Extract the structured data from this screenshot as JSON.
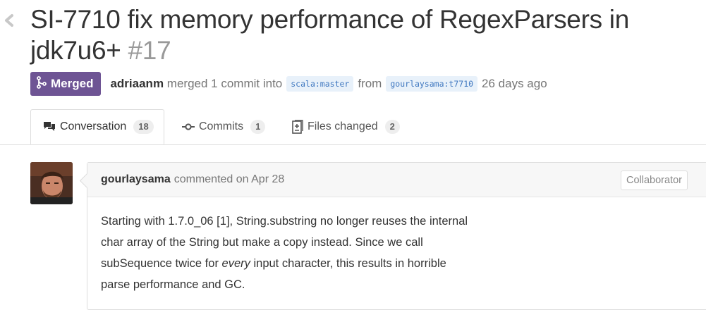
{
  "header": {
    "title": "SI-7710 fix memory performance of RegexParsers in jdk7u6+",
    "number": "#17",
    "back_icon": "chevron-left-icon"
  },
  "meta": {
    "state": "Merged",
    "state_color": "#6e5494",
    "author": "adriaanm",
    "merged_text": "merged 1 commit into",
    "base_ref": "scala:master",
    "from_text": "from",
    "head_ref": "gourlaysama:t7710",
    "time": "26 days ago"
  },
  "tabs": [
    {
      "label": "Conversation",
      "count": "18",
      "icon": "comment-discussion-icon",
      "selected": true
    },
    {
      "label": "Commits",
      "count": "1",
      "icon": "git-commit-icon",
      "selected": false
    },
    {
      "label": "Files changed",
      "count": "2",
      "icon": "diff-icon",
      "selected": false
    }
  ],
  "comment": {
    "author": "gourlaysama",
    "action": "commented on Apr 28",
    "role": "Collaborator",
    "lines": [
      "Starting with 1.7.0_06 [1], String.substring no longer reuses the internal",
      "char array of the String but make a copy instead. Since we call",
      "subSequence twice for",
      "every",
      "input character, this results in horrible",
      "parse performance and GC."
    ]
  }
}
